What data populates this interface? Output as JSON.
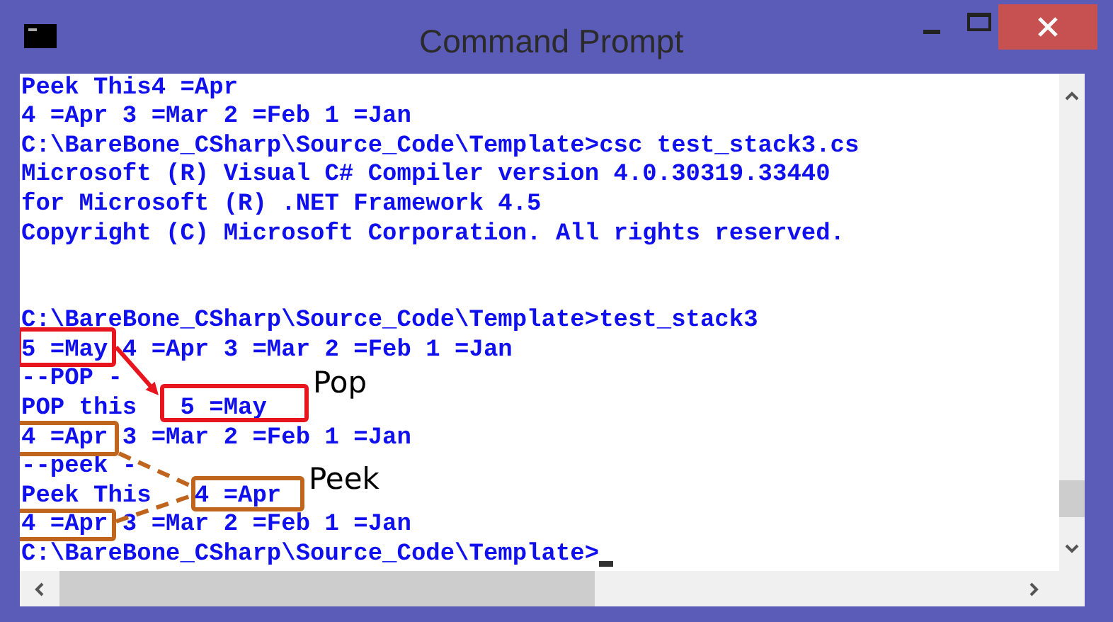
{
  "window": {
    "title": "Command Prompt"
  },
  "console": {
    "lines": [
      "Peek This4 =Apr",
      "4 =Apr 3 =Mar 2 =Feb 1 =Jan",
      "C:\\BareBone_CSharp\\Source_Code\\Template>csc test_stack3.cs",
      "Microsoft (R) Visual C# Compiler version 4.0.30319.33440",
      "for Microsoft (R) .NET Framework 4.5",
      "Copyright (C) Microsoft Corporation. All rights reserved."
    ],
    "lines_after_gap": [
      "C:\\BareBone_CSharp\\Source_Code\\Template>test_stack3",
      "5 =May 4 =Apr 3 =Mar 2 =Feb 1 =Jan",
      "--POP -",
      "POP this   5 =May",
      "4 =Apr 3 =Mar 2 =Feb 1 =Jan",
      "--peek -",
      "Peek This   4 =Apr",
      "4 =Apr 3 =Mar 2 =Feb 1 =Jan",
      "C:\\BareBone_CSharp\\Source_Code\\Template>"
    ],
    "cursor": true
  },
  "annotations": [
    {
      "kind": "box",
      "color": "#e8141e"
    },
    {
      "kind": "arrow",
      "color": "#e8141e"
    },
    {
      "kind": "box",
      "color": "#e8141e"
    },
    {
      "kind": "label",
      "text": "Pop"
    },
    {
      "kind": "box",
      "color": "#c0651e"
    },
    {
      "kind": "dashed-line",
      "color": "#c0651e"
    },
    {
      "kind": "box",
      "color": "#c0651e"
    },
    {
      "kind": "dashed-line",
      "color": "#c0651e"
    },
    {
      "kind": "box",
      "color": "#c0651e"
    },
    {
      "kind": "label",
      "text": "Peek"
    }
  ]
}
